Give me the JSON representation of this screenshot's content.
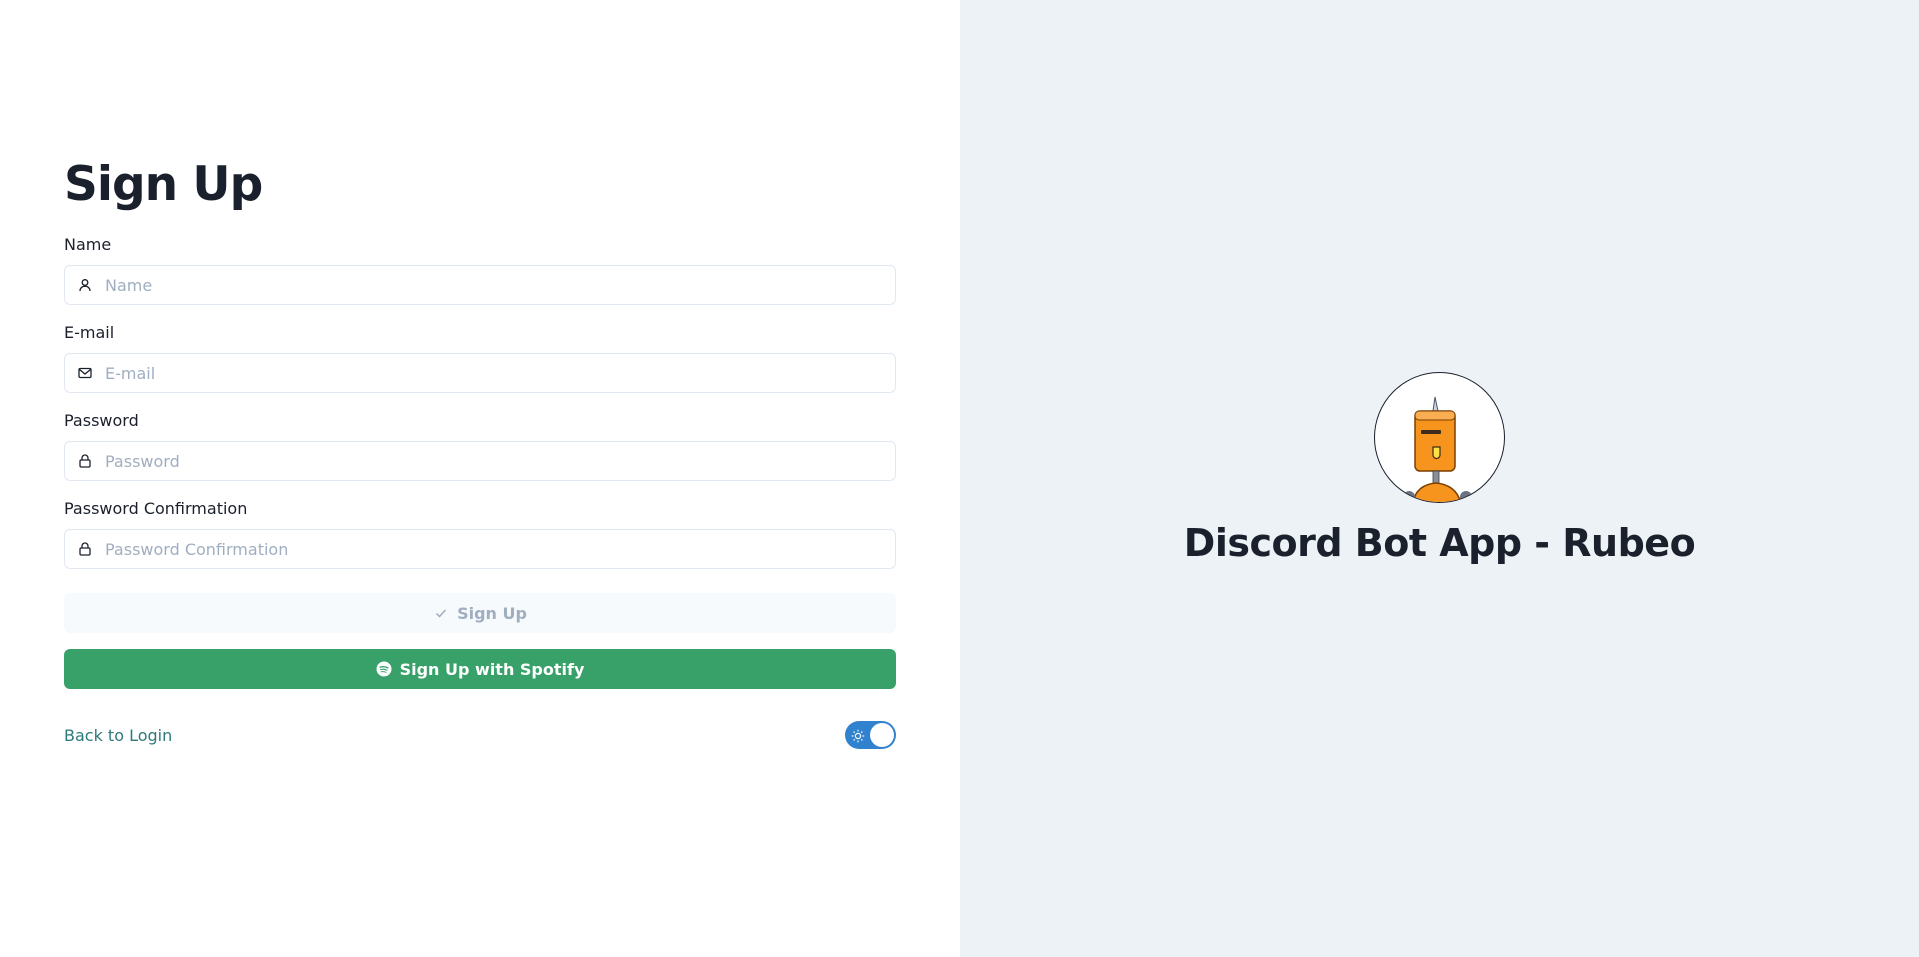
{
  "form": {
    "title": "Sign Up",
    "fields": [
      {
        "label": "Name",
        "placeholder": "Name",
        "icon": "user-icon"
      },
      {
        "label": "E-mail",
        "placeholder": "E-mail",
        "icon": "mail-icon"
      },
      {
        "label": "Password",
        "placeholder": "Password",
        "icon": "lock-icon"
      },
      {
        "label": "Password Confirmation",
        "placeholder": "Password Confirmation",
        "icon": "lock-icon"
      }
    ],
    "signup_label": "Sign Up",
    "spotify_label": "Sign Up with Spotify",
    "back_label": "Back to Login"
  },
  "brand": {
    "title": "Discord Bot App - Rubeo"
  },
  "colors": {
    "accent": "#3182ce",
    "spotify": "#38a169",
    "link": "#2c7a7b",
    "panel": "#edf2f7"
  }
}
